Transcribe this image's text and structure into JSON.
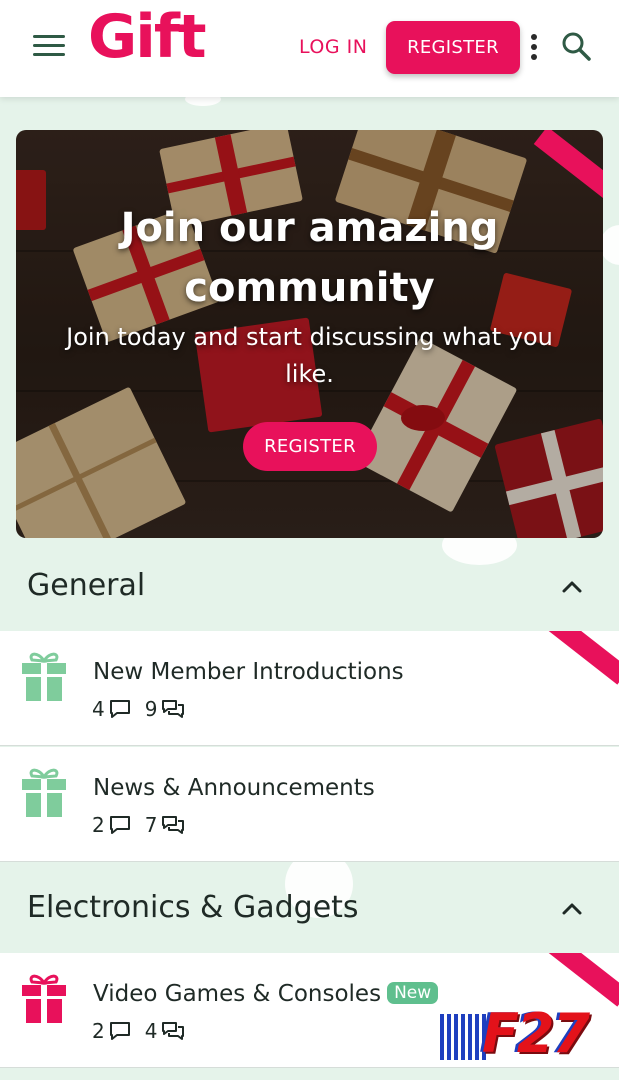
{
  "header": {
    "logo_text": "Gift",
    "login_label": "LOG IN",
    "register_label": "REGISTER",
    "menu_icon": "hamburger-icon",
    "more_icon": "kebab-icon",
    "search_icon": "search-icon"
  },
  "banner": {
    "title": "Join our amazing community",
    "subtitle": "Join today and start discussing what you like.",
    "register_label": "REGISTER"
  },
  "sections": [
    {
      "title": "General",
      "forums": [
        {
          "title": "New Member Introductions",
          "threads": "4",
          "messages": "9",
          "icon_color": "#7fcc9c"
        },
        {
          "title": "News & Announcements",
          "threads": "2",
          "messages": "7",
          "icon_color": "#7fcc9c"
        }
      ]
    },
    {
      "title": "Electronics & Gadgets",
      "forums": [
        {
          "title": "Video Games & Consoles",
          "badge": "New",
          "threads": "2",
          "messages": "4",
          "icon_color": "#e8115b"
        }
      ]
    }
  ],
  "watermark": {
    "text": "F27"
  },
  "colors": {
    "accent": "#e8115b",
    "green": "#7fcc9c",
    "bg": "#e5f3ea",
    "badge": "#5fbf8e"
  }
}
